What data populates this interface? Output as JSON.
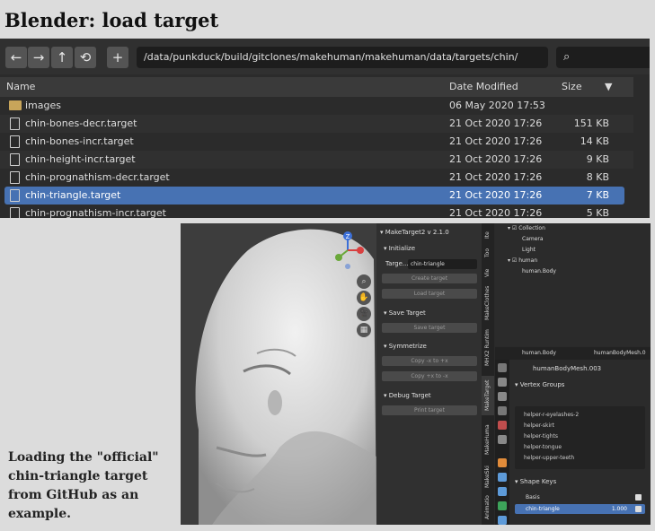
{
  "page": {
    "title": "Blender: load target"
  },
  "browser": {
    "nav": {
      "back": "←",
      "forward": "→",
      "parent": "↑",
      "refresh": "⟲",
      "new_folder": "+"
    },
    "path": "/data/punkduck/build/gitclones/makehuman/makehuman/data/targets/chin/",
    "search_icon": "⌕",
    "columns": {
      "name": "Name",
      "date": "Date Modified",
      "size": "Size",
      "sort": "▼"
    },
    "files": [
      {
        "name": "images",
        "date": "06 May 2020 17:53",
        "size": "",
        "type": "folder"
      },
      {
        "name": "chin-bones-decr.target",
        "date": "21 Oct 2020 17:26",
        "size": "151 KB",
        "type": "file"
      },
      {
        "name": "chin-bones-incr.target",
        "date": "21 Oct 2020 17:26",
        "size": "14 KB",
        "type": "file"
      },
      {
        "name": "chin-height-incr.target",
        "date": "21 Oct 2020 17:26",
        "size": "9 KB",
        "type": "file"
      },
      {
        "name": "chin-prognathism-decr.target",
        "date": "21 Oct 2020 17:26",
        "size": "8 KB",
        "type": "file"
      },
      {
        "name": "chin-triangle.target",
        "date": "21 Oct 2020 17:26",
        "size": "7 KB",
        "type": "file",
        "selected": true
      },
      {
        "name": "chin-prognathism-incr.target",
        "date": "21 Oct 2020 17:26",
        "size": "5 KB",
        "type": "file"
      }
    ]
  },
  "caption": "Loading the \"official\" chin-triangle target from GitHub as an example.",
  "viewport": {
    "axis_z": "Z",
    "gizmo_buttons": [
      "⌕",
      "✋",
      "🎥",
      "▦"
    ]
  },
  "npanel": {
    "title": "▾ MakeTarget2 v 2.1.0",
    "initialize": "▾ Initialize",
    "target_label": "Targe...",
    "target_value": "chin-triangle",
    "create_target": "Create target",
    "load_target": "Load target",
    "save_section": "▾ Save Target",
    "save_target": "Save target",
    "sym_section": "▾ Symmetrize",
    "copy_lr": "Copy -x to +x",
    "copy_rl": "Copy +x to -x",
    "debug_section": "▾ Debug Target",
    "print_target": "Print target"
  },
  "tabs": [
    "Ite",
    "Too",
    "Vie",
    "MakeClothes",
    "MHX2 Runtim",
    "MakeTarget",
    "MakeHuma",
    "MakeSki",
    "Animatio"
  ],
  "outliner": [
    {
      "label": "▾ ☑ Collection",
      "indent": 14
    },
    {
      "label": "Camera",
      "indent": 30
    },
    {
      "label": "Light",
      "indent": 30
    },
    {
      "label": "▾ ☑ human",
      "indent": 14
    },
    {
      "label": "human.Body",
      "indent": 30
    }
  ],
  "props": {
    "object_name": "human.Body",
    "mesh_name": "humanBodyMesh.0",
    "mesh_field": "humanBodyMesh.003",
    "vertex_groups_title": "▾ Vertex Groups",
    "vertex_groups": [
      "helper-r-eyelashes-2",
      "helper-skirt",
      "helper-tights",
      "helper-tongue",
      "helper-upper-teeth"
    ],
    "shape_keys_title": "▾ Shape Keys",
    "shape_keys": [
      {
        "name": "Basis",
        "value": ""
      },
      {
        "name": "chin-triangle",
        "value": "1.000",
        "selected": true
      }
    ]
  }
}
